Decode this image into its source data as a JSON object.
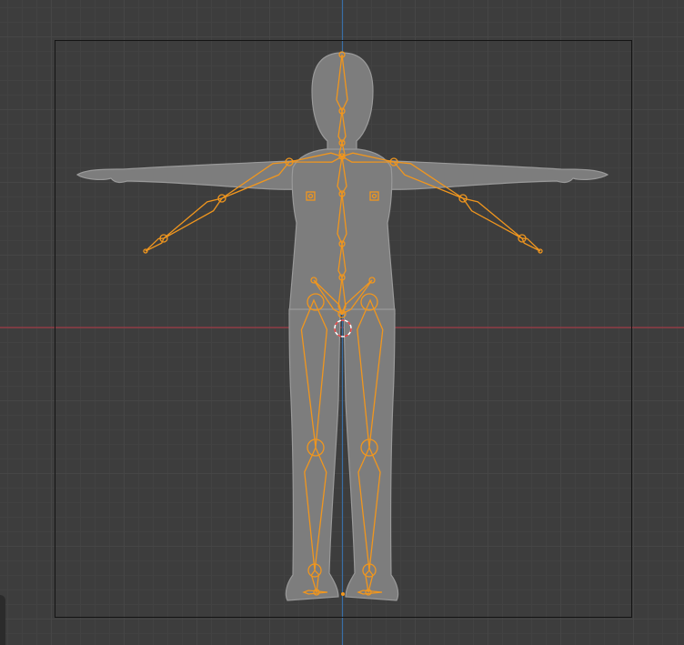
{
  "viewport": {
    "colors": {
      "background": "#3d3d3d",
      "grid_minor": "#424242",
      "grid_major": "#464646",
      "x_axis": "#a03a45",
      "z_axis": "#3a6ea5",
      "camera_frame": "#141414",
      "mesh": "#7d7d7d",
      "mesh_outline": "#9a9a9a",
      "armature_selected": "#f0961e",
      "cursor_red": "#e84040",
      "cursor_white": "#ffffff"
    },
    "objects": [
      {
        "name": "character-mesh",
        "kind": "mesh"
      },
      {
        "name": "armature",
        "kind": "armature",
        "selected": true
      },
      {
        "name": "3d-cursor",
        "kind": "cursor"
      },
      {
        "name": "camera-frame",
        "kind": "camera-border"
      }
    ],
    "icons": [
      "3d-cursor-icon",
      "bone-joint-icon",
      "custom-shape-icon"
    ]
  }
}
